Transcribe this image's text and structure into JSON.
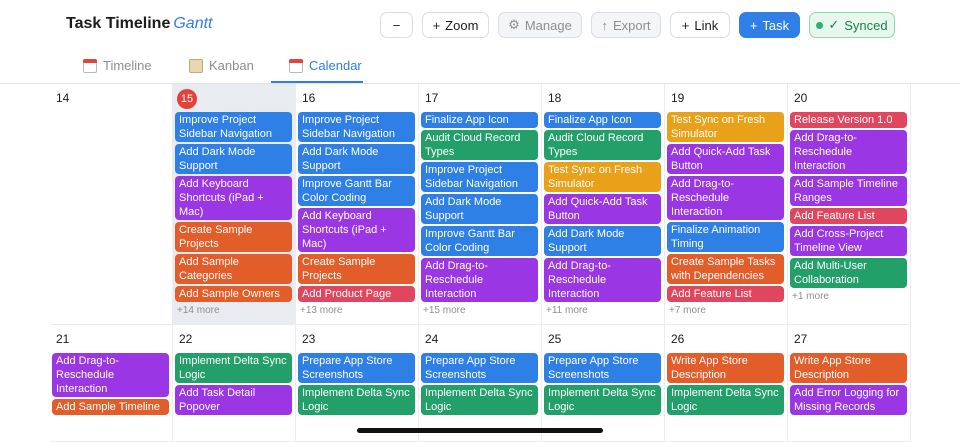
{
  "header": {
    "title": "Task Timeline",
    "title_accent": "Gantt",
    "buttons": {
      "zoom_out": "−",
      "zoom": "Zoom",
      "manage": "Manage",
      "export": "Export",
      "link": "Link",
      "task": "Task",
      "synced": "Synced"
    }
  },
  "tabs": [
    "Timeline",
    "Kanban",
    "Calendar"
  ],
  "colors": {
    "blue": "#2f80e6",
    "green": "#23a06a",
    "purple": "#9a36e3",
    "orange": "#e35d2b",
    "amber": "#e8a119",
    "pink": "#e0465e"
  },
  "calendar": {
    "weeks": [
      [
        {
          "day": "14",
          "events": [],
          "more": ""
        },
        {
          "day": "15",
          "today": true,
          "events": [
            {
              "t": "Improve Project Sidebar Navigation",
              "c": "blue"
            },
            {
              "t": "Add Dark Mode Support",
              "c": "blue"
            },
            {
              "t": "Add Keyboard Shortcuts (iPad + Mac)",
              "c": "purple"
            },
            {
              "t": "Create Sample Projects",
              "c": "orange"
            },
            {
              "t": "Add Sample Categories",
              "c": "orange"
            },
            {
              "t": "Add Sample Owners",
              "c": "orange"
            }
          ],
          "more": "+14 more"
        },
        {
          "day": "16",
          "events": [
            {
              "t": "Improve Project Sidebar Navigation",
              "c": "blue"
            },
            {
              "t": "Add Dark Mode Support",
              "c": "blue"
            },
            {
              "t": "Improve Gantt Bar Color Coding",
              "c": "blue"
            },
            {
              "t": "Add Keyboard Shortcuts (iPad + Mac)",
              "c": "purple"
            },
            {
              "t": "Create Sample Projects",
              "c": "orange"
            },
            {
              "t": "Add Product Page",
              "c": "pink"
            }
          ],
          "more": "+13 more"
        },
        {
          "day": "17",
          "events": [
            {
              "t": "Finalize App Icon",
              "c": "blue"
            },
            {
              "t": "Audit Cloud Record Types",
              "c": "green"
            },
            {
              "t": "Improve Project Sidebar Navigation",
              "c": "blue"
            },
            {
              "t": "Add Dark Mode Support",
              "c": "blue"
            },
            {
              "t": "Improve Gantt Bar Color Coding",
              "c": "blue"
            },
            {
              "t": "Add Drag-to-Reschedule Interaction",
              "c": "purple"
            }
          ],
          "more": "+15 more"
        },
        {
          "day": "18",
          "events": [
            {
              "t": "Finalize App Icon",
              "c": "blue"
            },
            {
              "t": "Audit Cloud Record Types",
              "c": "green"
            },
            {
              "t": "Test Sync on Fresh Simulator",
              "c": "amber"
            },
            {
              "t": "Add Quick-Add Task Button",
              "c": "purple"
            },
            {
              "t": "Add Dark Mode Support",
              "c": "blue"
            },
            {
              "t": "Add Drag-to-Reschedule Interaction",
              "c": "purple"
            }
          ],
          "more": "+11 more"
        },
        {
          "day": "19",
          "events": [
            {
              "t": "Test Sync on Fresh Simulator",
              "c": "amber"
            },
            {
              "t": "Add Quick-Add Task Button",
              "c": "purple"
            },
            {
              "t": "Add Drag-to-Reschedule Interaction",
              "c": "purple"
            },
            {
              "t": "Finalize Animation Timing",
              "c": "blue"
            },
            {
              "t": "Create Sample Tasks with Dependencies",
              "c": "orange"
            },
            {
              "t": "Add Feature List",
              "c": "pink"
            }
          ],
          "more": "+7 more"
        },
        {
          "day": "20",
          "events": [
            {
              "t": "Release Version 1.0",
              "c": "pink"
            },
            {
              "t": "Add Drag-to-Reschedule Interaction",
              "c": "purple"
            },
            {
              "t": "Add Sample Timeline Ranges",
              "c": "purple"
            },
            {
              "t": "Add Feature List",
              "c": "pink"
            },
            {
              "t": "Add Cross-Project Timeline View",
              "c": "purple"
            },
            {
              "t": "Add Multi-User Collaboration",
              "c": "green"
            }
          ],
          "more": "+1 more"
        }
      ],
      [
        {
          "day": "21",
          "events": [
            {
              "t": "Add Drag-to-Reschedule Interaction",
              "c": "purple"
            },
            {
              "t": "Add Sample Timeline",
              "c": "orange"
            }
          ],
          "more": ""
        },
        {
          "day": "22",
          "events": [
            {
              "t": "Implement Delta Sync Logic",
              "c": "green"
            },
            {
              "t": "Add Task Detail Popover",
              "c": "purple"
            }
          ],
          "more": ""
        },
        {
          "day": "23",
          "events": [
            {
              "t": "Prepare App Store Screenshots",
              "c": "blue"
            },
            {
              "t": "Implement Delta Sync Logic",
              "c": "green"
            }
          ],
          "more": ""
        },
        {
          "day": "24",
          "events": [
            {
              "t": "Prepare App Store Screenshots",
              "c": "blue"
            },
            {
              "t": "Implement Delta Sync Logic",
              "c": "green"
            }
          ],
          "more": ""
        },
        {
          "day": "25",
          "events": [
            {
              "t": "Prepare App Store Screenshots",
              "c": "blue"
            },
            {
              "t": "Implement Delta Sync Logic",
              "c": "green"
            }
          ],
          "more": ""
        },
        {
          "day": "26",
          "events": [
            {
              "t": "Write App Store Description",
              "c": "orange"
            },
            {
              "t": "Implement Delta Sync Logic",
              "c": "green"
            }
          ],
          "more": ""
        },
        {
          "day": "27",
          "events": [
            {
              "t": "Write App Store Description",
              "c": "orange"
            },
            {
              "t": "Add Error Logging for Missing Records",
              "c": "purple"
            }
          ],
          "more": ""
        }
      ]
    ]
  }
}
